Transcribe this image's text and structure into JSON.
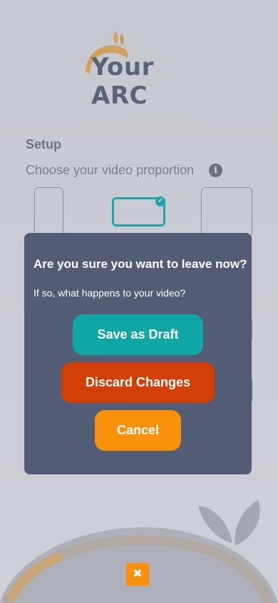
{
  "brand": {
    "logo_text": "Your ARC"
  },
  "setup": {
    "title": "Setup",
    "subtitle": "Choose your video proportion",
    "info_icon": "i",
    "options": [
      {
        "name": "portrait",
        "selected": false
      },
      {
        "name": "landscape",
        "selected": true
      },
      {
        "name": "square",
        "selected": false
      }
    ],
    "check_mark": "✓"
  },
  "modal": {
    "title": "Are you sure you want to leave now?",
    "subtitle": "If so, what happens to your video?",
    "save_draft_label": "Save as Draft",
    "discard_label": "Discard Changes",
    "cancel_label": "Cancel"
  },
  "close_button": {
    "label": "✖"
  },
  "colors": {
    "teal": "#11a6a6",
    "red": "#d43f07",
    "orange": "#f8900a",
    "modal_bg": "#525c74",
    "logo_gold": "#d4a15a"
  }
}
